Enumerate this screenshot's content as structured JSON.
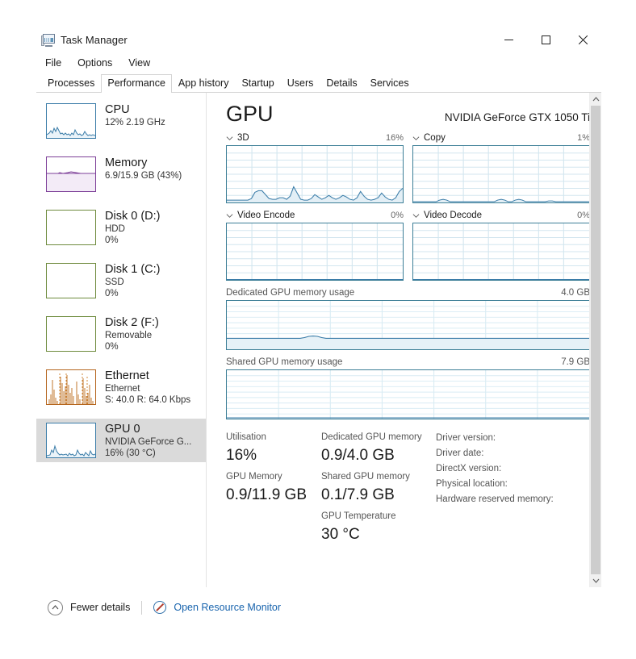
{
  "window": {
    "title": "Task Manager",
    "icon": "task-manager-icon",
    "minimize": "─",
    "maximize": "□",
    "close": "✕"
  },
  "menu": {
    "items": [
      "File",
      "Options",
      "View"
    ]
  },
  "tabs": [
    {
      "label": "Processes",
      "selected": false
    },
    {
      "label": "Performance",
      "selected": true
    },
    {
      "label": "App history",
      "selected": false
    },
    {
      "label": "Startup",
      "selected": false
    },
    {
      "label": "Users",
      "selected": false
    },
    {
      "label": "Details",
      "selected": false
    },
    {
      "label": "Services",
      "selected": false
    }
  ],
  "sidebar": {
    "items": [
      {
        "name": "CPU",
        "line1": "12% 2.19 GHz",
        "line2": "",
        "selected": false,
        "color": "#3a7ca8"
      },
      {
        "name": "Memory",
        "line1": "6.9/15.9 GB (43%)",
        "line2": "",
        "selected": false,
        "color": "#7d3f98"
      },
      {
        "name": "Disk 0 (D:)",
        "line1": "HDD",
        "line2": "0%",
        "selected": false,
        "color": "#6e8b3d"
      },
      {
        "name": "Disk 1 (C:)",
        "line1": "SSD",
        "line2": "0%",
        "selected": false,
        "color": "#6e8b3d"
      },
      {
        "name": "Disk 2 (F:)",
        "line1": "Removable",
        "line2": "0%",
        "selected": false,
        "color": "#6e8b3d"
      },
      {
        "name": "Ethernet",
        "line1": "Ethernet",
        "line2": "S: 40.0 R: 64.0 Kbps",
        "selected": false,
        "color": "#b5651d"
      },
      {
        "name": "GPU 0",
        "line1": "NVIDIA GeForce G...",
        "line2": "16% (30 °C)",
        "selected": true,
        "color": "#3a7ca8"
      }
    ]
  },
  "main": {
    "heading": "GPU",
    "device": "NVIDIA GeForce GTX 1050 Ti",
    "engines": [
      {
        "label": "3D",
        "percent": "16%"
      },
      {
        "label": "Copy",
        "percent": "1%"
      },
      {
        "label": "Video Encode",
        "percent": "0%"
      },
      {
        "label": "Video Decode",
        "percent": "0%"
      }
    ],
    "memory_graphs": [
      {
        "label": "Dedicated GPU memory usage",
        "max": "4.0 GB"
      },
      {
        "label": "Shared GPU memory usage",
        "max": "7.9 GB"
      }
    ],
    "stats": {
      "col1": [
        {
          "label": "Utilisation",
          "value": "16%"
        },
        {
          "label": "GPU Memory",
          "value": "0.9/11.9 GB"
        }
      ],
      "col2": [
        {
          "label": "Dedicated GPU memory",
          "value": "0.9/4.0 GB"
        },
        {
          "label": "Shared GPU memory",
          "value": "0.1/7.9 GB"
        },
        {
          "label": "GPU Temperature",
          "value": "30 °C"
        }
      ],
      "col3": [
        "Driver version:",
        "Driver date:",
        "DirectX version:",
        "Physical location:",
        "Hardware reserved memory:"
      ]
    }
  },
  "footer": {
    "fewer_details": "Fewer details",
    "resource_monitor": "Open Resource Monitor"
  },
  "colors": {
    "graph_border": "#3c7e96",
    "graph_line": "#3a7ca8",
    "graph_fill": "#dbeaf3",
    "link": "#1763ad",
    "selection": "#dadada"
  },
  "chart_data": [
    {
      "type": "line",
      "title": "3D",
      "ylabel": "Utilisation %",
      "ylim": [
        0,
        100
      ],
      "current": 16,
      "values": [
        2,
        2,
        2,
        2,
        2,
        2,
        2,
        3,
        2,
        2,
        3,
        2,
        2,
        14,
        16,
        18,
        15,
        16,
        15,
        8,
        5,
        4,
        5,
        5,
        6,
        5,
        4,
        6,
        22,
        28,
        12,
        5,
        3,
        3,
        4,
        4,
        9,
        11,
        6,
        4,
        4,
        3,
        12,
        14,
        8,
        4,
        6,
        9,
        6,
        4,
        3,
        4,
        18,
        24,
        10,
        4,
        3,
        3,
        4,
        6,
        14,
        16,
        7,
        4,
        3,
        4,
        8,
        18,
        20
      ]
    },
    {
      "type": "line",
      "title": "Copy",
      "ylabel": "Utilisation %",
      "ylim": [
        0,
        100
      ],
      "current": 1,
      "values": [
        0,
        0,
        0,
        0,
        0,
        0,
        0,
        0,
        0,
        0,
        0,
        0,
        0,
        0,
        2,
        3,
        2,
        1,
        0,
        0,
        0,
        0,
        0,
        0,
        0,
        0,
        0,
        0,
        0,
        0,
        0,
        0,
        0,
        0,
        0,
        0,
        0,
        2,
        2,
        0,
        0,
        0,
        0,
        2,
        3,
        2,
        0,
        0,
        0,
        0,
        0,
        0,
        0,
        0,
        0,
        0,
        1,
        1,
        0,
        0,
        0,
        0,
        0,
        0,
        0,
        0,
        0,
        0,
        0
      ]
    },
    {
      "type": "line",
      "title": "Video Encode",
      "ylabel": "Utilisation %",
      "ylim": [
        0,
        100
      ],
      "current": 0,
      "values": [
        0,
        0,
        0,
        0,
        0,
        0,
        0,
        0,
        0,
        0,
        0,
        0,
        0,
        0,
        0,
        0,
        0,
        0,
        0,
        0,
        0,
        0,
        0,
        0,
        0,
        0,
        0,
        0,
        0,
        0,
        0,
        0,
        0,
        0,
        0,
        0,
        0,
        0,
        0,
        0
      ]
    },
    {
      "type": "line",
      "title": "Video Decode",
      "ylabel": "Utilisation %",
      "ylim": [
        0,
        100
      ],
      "current": 0,
      "values": [
        0,
        0,
        0,
        0,
        0,
        0,
        0,
        0,
        0,
        0,
        0,
        0,
        0,
        0,
        0,
        0,
        0,
        0,
        0,
        0,
        0,
        0,
        0,
        0,
        0,
        0,
        0,
        0,
        0,
        0,
        0,
        0,
        0,
        0,
        0,
        0,
        0,
        0,
        0,
        0
      ]
    },
    {
      "type": "area",
      "title": "Dedicated GPU memory usage",
      "ylabel": "GB",
      "ylim": [
        0,
        4.0
      ],
      "current": 0.9,
      "values": [
        0.9,
        0.9,
        0.9,
        0.9,
        0.9,
        0.9,
        0.9,
        0.9,
        0.9,
        0.9,
        0.9,
        0.95,
        1.0,
        1.02,
        1.0,
        0.95,
        0.9,
        0.9,
        0.9,
        0.9,
        0.9,
        0.9,
        0.9,
        0.9,
        0.9,
        0.9,
        0.9,
        0.9,
        0.9,
        0.9,
        0.9,
        0.9,
        0.9,
        0.9,
        0.9,
        0.9,
        0.9,
        0.9,
        0.9,
        0.9
      ]
    },
    {
      "type": "area",
      "title": "Shared GPU memory usage",
      "ylabel": "GB",
      "ylim": [
        0,
        7.9
      ],
      "current": 0.1,
      "values": [
        0.1,
        0.1,
        0.1,
        0.1,
        0.1,
        0.1,
        0.1,
        0.1,
        0.1,
        0.1,
        0.1,
        0.1,
        0.1,
        0.1,
        0.1,
        0.1,
        0.1,
        0.1,
        0.1,
        0.1,
        0.1,
        0.1,
        0.1,
        0.1,
        0.1,
        0.1,
        0.1,
        0.1,
        0.1,
        0.1,
        0.1,
        0.1,
        0.1,
        0.1,
        0.1,
        0.1,
        0.1,
        0.1,
        0.1,
        0.1
      ]
    }
  ]
}
